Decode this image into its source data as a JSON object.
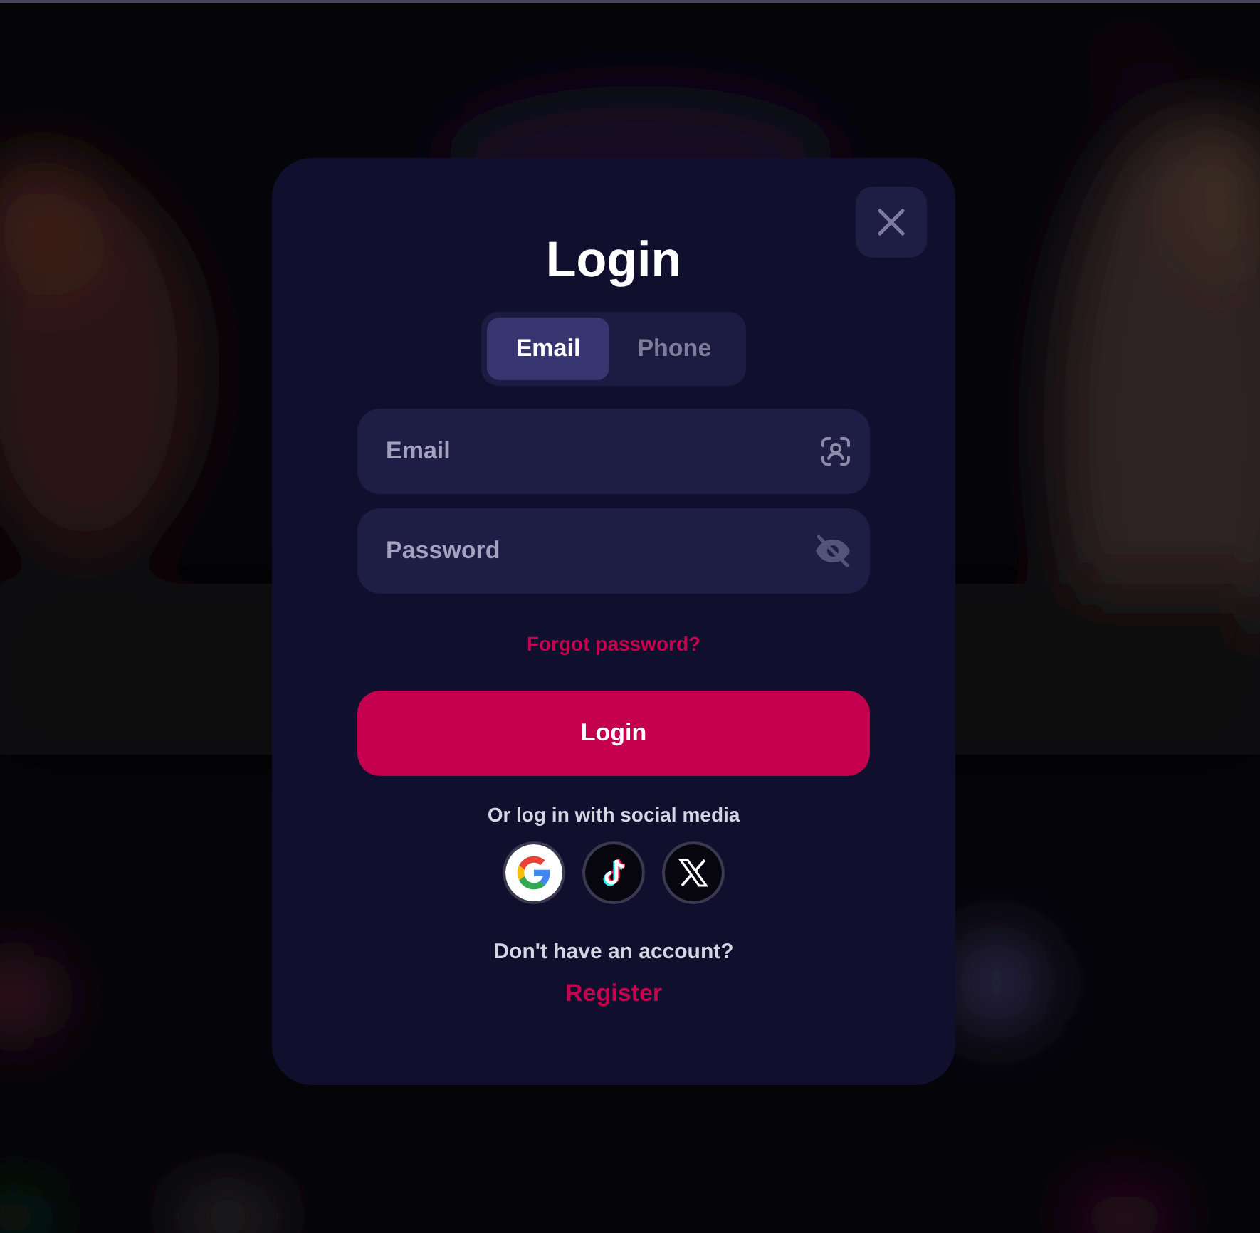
{
  "modal": {
    "title": "Login",
    "tabs": [
      {
        "label": "Email",
        "selected": true
      },
      {
        "label": "Phone",
        "selected": false
      }
    ],
    "fields": [
      {
        "kind": "email",
        "placeholder": "Email"
      },
      {
        "kind": "password",
        "placeholder": "Password"
      }
    ],
    "forgot_link": "Forgot password?",
    "submit": "Login",
    "social_caption": "Or log in with social media",
    "social": [
      {
        "kind": "google"
      },
      {
        "kind": "tiktok"
      },
      {
        "kind": "x"
      }
    ],
    "register_prompt": "Don't have an account?",
    "register_link": "Register"
  }
}
